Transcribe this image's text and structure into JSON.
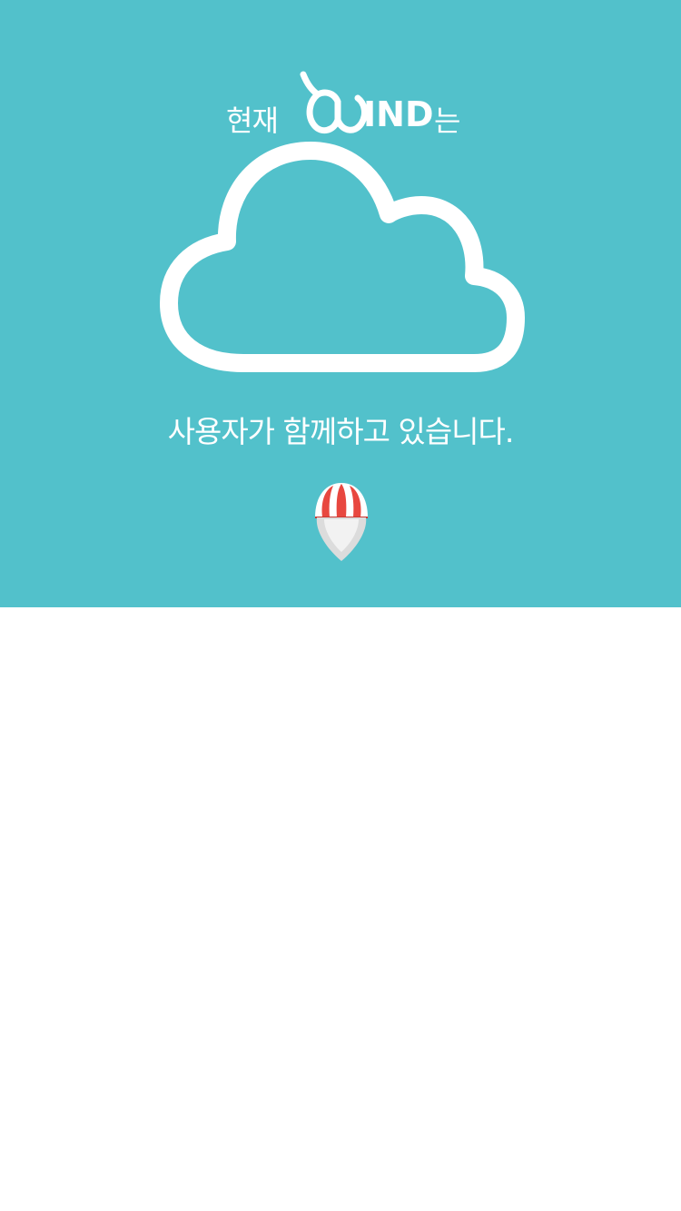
{
  "header": {
    "prefix": "현재",
    "logo_text": "IND",
    "suffix": "는"
  },
  "main": {
    "subtitle": "사용자가 함께하고 있습니다."
  },
  "icons": {
    "logo": "wind-logo-icon",
    "cloud": "cloud-icon",
    "pin": "balloon-location-pin-icon"
  },
  "colors": {
    "hero_background": "#52c1cb",
    "foreground": "#ffffff",
    "pin_red": "#e8473f",
    "pin_gray": "#dcdcdc",
    "page_background": "#ffffff"
  }
}
